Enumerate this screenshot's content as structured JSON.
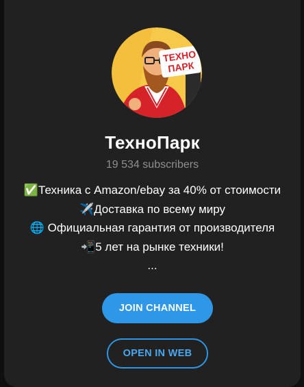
{
  "channel": {
    "name": "ТехноПарк",
    "subscribers": "19 534 subscribers",
    "avatar_text_line1": "ТЕХНО",
    "avatar_text_line2": "ПАРК",
    "description": [
      "✅Техника с Amazon/ebay за 40% от стоимости",
      "✈️Доставка по всему миру",
      "🌐 Официальная гарантия от производителя",
      "📲5 лет на рынке техники!",
      "..."
    ]
  },
  "actions": {
    "join_label": "JOIN CHANNEL",
    "web_label": "OPEN IN WEB"
  },
  "colors": {
    "accent": "#2f97e8",
    "card_bg": "#212121",
    "page_bg": "#0f0f10",
    "muted_text": "#8f8f8f"
  }
}
